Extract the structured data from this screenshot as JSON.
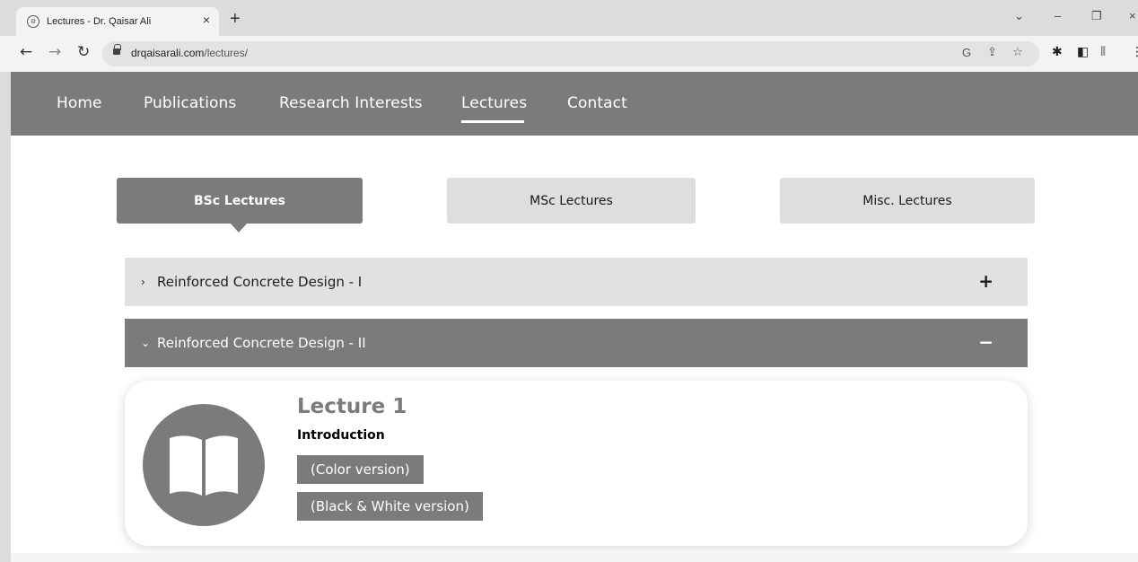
{
  "browser": {
    "tab_title": "Lectures - Dr. Qaisar Ali",
    "tab_close": "×",
    "new_tab": "+",
    "url_domain": "drqaisarali.com",
    "url_path": "/lectures/",
    "icons": [
      "back-icon",
      "forward-icon",
      "reload-icon",
      "lock-icon",
      "google-icon",
      "share-icon",
      "star-icon",
      "extensions-icon",
      "sidepanel-icon",
      "menu-icon"
    ]
  },
  "site_nav": {
    "items": [
      {
        "label": "Home"
      },
      {
        "label": "Publications"
      },
      {
        "label": "Research Interests"
      },
      {
        "label": "Lectures"
      },
      {
        "label": "Contact"
      }
    ],
    "active": "Lectures"
  },
  "categories": {
    "bsc": "BSc Lectures",
    "msc": "MSc Lectures",
    "misc": "Misc. Lectures",
    "active": "BSc Lectures"
  },
  "accordions": [
    {
      "title": "Reinforced Concrete Design - I",
      "chevron": "›",
      "toggle": "+",
      "expanded": false
    },
    {
      "title": "Reinforced Concrete Design - II",
      "chevron": "⌄",
      "toggle": "−",
      "expanded": true
    }
  ],
  "lecture": {
    "title": "Lecture 1",
    "subtitle": "Introduction",
    "color_btn": "(Color version)",
    "bw_btn": "(Black & White version)",
    "icon": "book-icon"
  },
  "colors": {
    "accent_gray": "#7b7b7b",
    "light_gray": "#e1e1e1",
    "white": "#ffffff"
  }
}
